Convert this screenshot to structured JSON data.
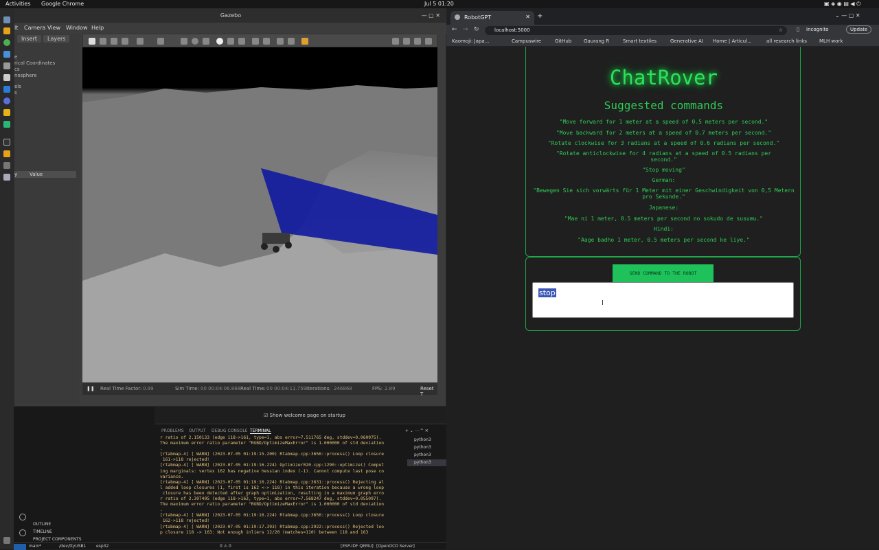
{
  "topbar": {
    "activities": "Activities",
    "app": "Google Chrome",
    "clock": "Jul 5  01:20"
  },
  "gazebo": {
    "title": "Gazebo",
    "menu": [
      "lt",
      "Camera",
      "View",
      "Window",
      "Help"
    ],
    "tabs": [
      "Insert",
      "Layers"
    ],
    "tree": [
      "e",
      "rical Coordinates",
      "cs",
      "nosphere",
      "els",
      "s"
    ],
    "prop_headers": [
      "y",
      "Value"
    ],
    "status": {
      "rtf_label": "Real Time Factor:",
      "rtf": "0.99",
      "sim_label": "Sim Time:",
      "sim": "00 00:04:06.868",
      "real_label": "Real Time:",
      "real": "00 00:04:11.759",
      "iter_label": "Iterations:",
      "iter": "246868",
      "fps_label": "FPS:",
      "fps": "2.89",
      "reset": "Reset T"
    }
  },
  "vscode": {
    "welcome": "Show welcome page on startup",
    "tabs": [
      "PROBLEMS",
      "OUTPUT",
      "DEBUG CONSOLE",
      "TERMINAL"
    ],
    "side_sections": [
      "OUTLINE",
      "TIMELINE",
      "PROJECT COMPONENTS"
    ],
    "processes": [
      "python3",
      "python3",
      "python3",
      "python3"
    ],
    "terminal_lines": [
      "r ratio of 2.150133 (edge 118->161, type=1, abs error=7.511765 deg, stddev=0.060975).",
      "The maximum error ratio parameter \"RGBD/OptimizeMaxError\" is 1.000000 of std deviation",
      ".",
      "[rtabmap-4] [ WARN] (2023-07-05 01:19:15.200) Rtabmap.cpp:3656::process() Loop closure",
      " 161->118 rejected!",
      "[rtabmap-4] [ WARN] (2023-07-05 01:19:16.224) Optimizer020.cpp:1290::optimize() Comput",
      "ing marginals: vertex 162 has negative hessian index (-1). Cannot compute last pose co",
      "variance.",
      "[rtabmap-4] [ WARN] (2023-07-05 01:19:16.224) Rtabmap.cpp:3631::process() Rejecting al",
      "l added loop closures (1, first is 162 <-> 118) in this iteration because a wrong loop",
      " closure has been detected after graph optimization, resulting in a maximum graph erro",
      "r ratio of 2.397405 (edge 118->162, type=1, abs error=7.568247 deg, stddev=0.055097).",
      "The maximum error ratio parameter \"RGBD/OptimizeMaxError\" is 1.000000 of std deviation",
      ".",
      "[rtabmap-4] [ WARN] (2023-07-05 01:19:16.224) Rtabmap.cpp:3656::process() Loop closure",
      " 162->118 rejected!",
      "[rtabmap-4] [ WARN] (2023-07-05 01:19:17.393) Rtabmap.cpp:2922::process() Rejected loo",
      "p closure 118 -> 163: Not enough inliers 12/20 (matches=110) between 118 and 163"
    ],
    "status": {
      "branch": "main*",
      "port": "/dev/ttyUSB1",
      "target": "esp32",
      "problems": "0 ⚠ 0",
      "idf": "[ESP-IDF QEMU]",
      "ocd": "[OpenOCD Server]"
    }
  },
  "chrome": {
    "tab_title": "RobotGPT",
    "url": "localhost:5000",
    "incognito": "Incognito",
    "update": "Update",
    "bookmarks": [
      "Kaomoji: Japa...",
      "Campuswire",
      "GitHub",
      "Gaurang R",
      "Smart textiles",
      "Generative AI",
      "Home | Articul...",
      "all research links",
      "MLH work"
    ]
  },
  "app": {
    "logo": "ChatRover",
    "heading": "Suggested commands",
    "commands": [
      "\"Move forward for 1 meter at a speed of 0.5 meters per second.\"",
      "\"Move backward for 2 meters at a speed of 0.7 meters per second.\"",
      "\"Rotate clockwise for 3 radians at a speed of 0.6 radians per second.\"",
      "\"Rotate anticlockwise for 4 radians at a speed of 0.5 radians per second.\"",
      "\"Stop moving\"",
      "German:",
      "\"Bewegen Sie sich vorwärts für 1 Meter mit einer Geschwindigkeit von 0,5 Metern pro Sekunde.\"",
      "Japanese:",
      "\"Mae ni 1 meter, 0.5 meters per second no sokudo de susumu.\"",
      "Hindi:",
      "\"Aage badho 1 meter, 0.5 meters per second ke liye.\""
    ],
    "send_label": "SEND COMMAND TO THE ROBOT",
    "input_value": "stop"
  }
}
